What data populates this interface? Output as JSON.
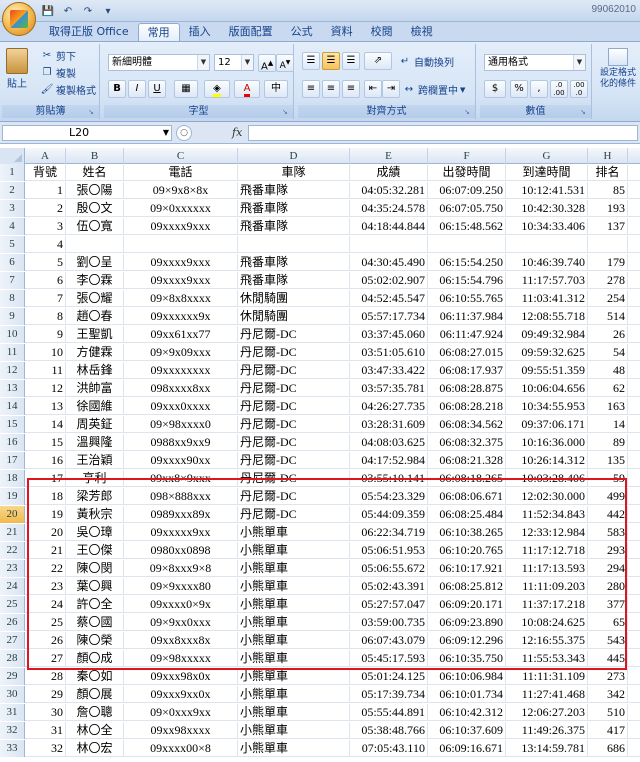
{
  "app": {
    "window_title": "99062010"
  },
  "tabs": [
    "取得正版 Office",
    "常用",
    "插入",
    "版面配置",
    "公式",
    "資料",
    "校閱",
    "檢視"
  ],
  "active_tab": "常用",
  "ribbon": {
    "clipboard": {
      "paste": "貼上",
      "cut": "剪下",
      "copy": "複製",
      "format_painter": "複製格式",
      "label": "剪貼簿"
    },
    "font": {
      "name": "新細明體",
      "size": "12",
      "grow": "A",
      "shrink": "A",
      "bold": "B",
      "italic": "I",
      "underline": "U",
      "phonetic": "中",
      "label": "字型"
    },
    "alignment": {
      "wrap": "自動換列",
      "merge": "跨欄置中",
      "label": "對齊方式"
    },
    "number": {
      "format": "通用格式",
      "currency": "$",
      "percent": "%",
      "comma": ",",
      "inc_decimal": ".0 .00",
      "dec_decimal": ".00 .0",
      "label": "數值"
    },
    "styles": {
      "conditional": "設定格式化的條件"
    }
  },
  "formula_bar": {
    "name_box": "L20",
    "fx": "fx",
    "value": ""
  },
  "columns": [
    "A",
    "B",
    "C",
    "D",
    "E",
    "F",
    "G",
    "H"
  ],
  "rows": [
    {
      "n": "1",
      "cells": [
        "背號",
        "姓名",
        "電話",
        "車隊",
        "成績",
        "出發時間",
        "到達時間",
        "排名"
      ]
    },
    {
      "n": "2",
      "cells": [
        "1",
        "張〇陽",
        "09×9x8×8x",
        "飛番車隊",
        "04:05:32.281",
        "06:07:09.250",
        "10:12:41.531",
        "85"
      ]
    },
    {
      "n": "3",
      "cells": [
        "2",
        "殷〇文",
        "09×0xxxxxx",
        "飛番車隊",
        "04:35:24.578",
        "06:07:05.750",
        "10:42:30.328",
        "193"
      ]
    },
    {
      "n": "4",
      "cells": [
        "3",
        "伍〇寬",
        "09xxxx9xxx",
        "飛番車隊",
        "04:18:44.844",
        "06:15:48.562",
        "10:34:33.406",
        "137"
      ]
    },
    {
      "n": "5",
      "cells": [
        "4",
        "",
        "",
        "",
        "",
        "",
        "",
        ""
      ]
    },
    {
      "n": "6",
      "cells": [
        "5",
        "劉〇呈",
        "09xxxx9xxx",
        "飛番車隊",
        "04:30:45.490",
        "06:15:54.250",
        "10:46:39.740",
        "179"
      ]
    },
    {
      "n": "7",
      "cells": [
        "6",
        "李〇霖",
        "09xxxx9xxx",
        "飛番車隊",
        "05:02:02.907",
        "06:15:54.796",
        "11:17:57.703",
        "278"
      ]
    },
    {
      "n": "8",
      "cells": [
        "7",
        "張〇耀",
        "09×8x8xxxx",
        "休閒騎團",
        "04:52:45.547",
        "06:10:55.765",
        "11:03:41.312",
        "254"
      ]
    },
    {
      "n": "9",
      "cells": [
        "8",
        "趙〇春",
        "09xxxxxx9x",
        "休閒騎團",
        "05:57:17.734",
        "06:11:37.984",
        "12:08:55.718",
        "514"
      ]
    },
    {
      "n": "10",
      "cells": [
        "9",
        "王聖凱",
        "09xx61xx77",
        "丹尼爾-DC",
        "03:37:45.060",
        "06:11:47.924",
        "09:49:32.984",
        "26"
      ]
    },
    {
      "n": "11",
      "cells": [
        "10",
        "方健霖",
        "09×9x09xxx",
        "丹尼爾-DC",
        "03:51:05.610",
        "06:08:27.015",
        "09:59:32.625",
        "54"
      ]
    },
    {
      "n": "12",
      "cells": [
        "11",
        "林岳鋒",
        "09xxxxxxxx",
        "丹尼爾-DC",
        "03:47:33.422",
        "06:08:17.937",
        "09:55:51.359",
        "48"
      ]
    },
    {
      "n": "13",
      "cells": [
        "12",
        "洪帥富",
        "098xxxx8xx",
        "丹尼爾-DC",
        "03:57:35.781",
        "06:08:28.875",
        "10:06:04.656",
        "62"
      ]
    },
    {
      "n": "14",
      "cells": [
        "13",
        "徐國維",
        "09xxx0xxxx",
        "丹尼爾-DC",
        "04:26:27.735",
        "06:08:28.218",
        "10:34:55.953",
        "163"
      ]
    },
    {
      "n": "15",
      "cells": [
        "14",
        "周英鉦",
        "09×98xxxx0",
        "丹尼爾-DC",
        "03:28:31.609",
        "06:08:34.562",
        "09:37:06.171",
        "14"
      ]
    },
    {
      "n": "16",
      "cells": [
        "15",
        "溫興隆",
        "0988xx9xx9",
        "丹尼爾-DC",
        "04:08:03.625",
        "06:08:32.375",
        "10:16:36.000",
        "89"
      ]
    },
    {
      "n": "17",
      "cells": [
        "16",
        "王治穎",
        "09xxxx90xx",
        "丹尼爾-DC",
        "04:17:52.984",
        "06:08:21.328",
        "10:26:14.312",
        "135"
      ]
    },
    {
      "n": "18",
      "cells": [
        "17",
        "亨利",
        "09xx8×9xxx",
        "丹尼爾-DC",
        "03:55:10.141",
        "06:08:18.265",
        "10:03:28.406",
        "59"
      ]
    },
    {
      "n": "19",
      "cells": [
        "18",
        "梁芳郎",
        "098×888xxx",
        "丹尼爾-DC",
        "05:54:23.329",
        "06:08:06.671",
        "12:02:30.000",
        "499"
      ]
    },
    {
      "n": "20",
      "cells": [
        "19",
        "黃秋宗",
        "0989xxx89x",
        "丹尼爾-DC",
        "05:44:09.359",
        "06:08:25.484",
        "11:52:34.843",
        "442"
      ]
    },
    {
      "n": "21",
      "cells": [
        "20",
        "吳〇璋",
        "09xxxxx9xx",
        "小熊單車",
        "06:22:34.719",
        "06:10:38.265",
        "12:33:12.984",
        "583"
      ]
    },
    {
      "n": "22",
      "cells": [
        "21",
        "王〇傑",
        "0980xx0898",
        "小熊單車",
        "05:06:51.953",
        "06:10:20.765",
        "11:17:12.718",
        "293"
      ]
    },
    {
      "n": "23",
      "cells": [
        "22",
        "陳〇閔",
        "09×8xxx9×8",
        "小熊單車",
        "05:06:55.672",
        "06:10:17.921",
        "11:17:13.593",
        "294"
      ]
    },
    {
      "n": "24",
      "cells": [
        "23",
        "葉〇興",
        "09×9xxxx80",
        "小熊單車",
        "05:02:43.391",
        "06:08:25.812",
        "11:11:09.203",
        "280"
      ]
    },
    {
      "n": "25",
      "cells": [
        "24",
        "許〇全",
        "09xxxx0×9x",
        "小熊單車",
        "05:27:57.047",
        "06:09:20.171",
        "11:37:17.218",
        "377"
      ]
    },
    {
      "n": "26",
      "cells": [
        "25",
        "蔡〇國",
        "09×9xx0xxx",
        "小熊單車",
        "03:59:00.735",
        "06:09:23.890",
        "10:08:24.625",
        "65"
      ]
    },
    {
      "n": "27",
      "cells": [
        "26",
        "陳〇榮",
        "09xx8xxx8x",
        "小熊單車",
        "06:07:43.079",
        "06:09:12.296",
        "12:16:55.375",
        "543"
      ]
    },
    {
      "n": "28",
      "cells": [
        "27",
        "顏〇成",
        "09×98xxxxx",
        "小熊單車",
        "05:45:17.593",
        "06:10:35.750",
        "11:55:53.343",
        "445"
      ]
    },
    {
      "n": "29",
      "cells": [
        "28",
        "秦〇如",
        "09xxx98x0x",
        "小熊單車",
        "05:01:24.125",
        "06:10:06.984",
        "11:11:31.109",
        "273"
      ]
    },
    {
      "n": "30",
      "cells": [
        "29",
        "顏〇展",
        "09xxx9xx0x",
        "小熊單車",
        "05:17:39.734",
        "06:10:01.734",
        "11:27:41.468",
        "342"
      ]
    },
    {
      "n": "31",
      "cells": [
        "30",
        "詹〇聰",
        "09×0xxx9xx",
        "小熊單車",
        "05:55:44.891",
        "06:10:42.312",
        "12:06:27.203",
        "510"
      ]
    },
    {
      "n": "32",
      "cells": [
        "31",
        "林〇全",
        "09xx98xxxx",
        "小熊單車",
        "05:38:48.766",
        "06:10:37.609",
        "11:49:26.375",
        "417"
      ]
    },
    {
      "n": "33",
      "cells": [
        "32",
        "林〇宏",
        "09xxxx00×8",
        "小熊單車",
        "07:05:43.110",
        "06:09:16.671",
        "13:14:59.781",
        "686"
      ]
    }
  ]
}
